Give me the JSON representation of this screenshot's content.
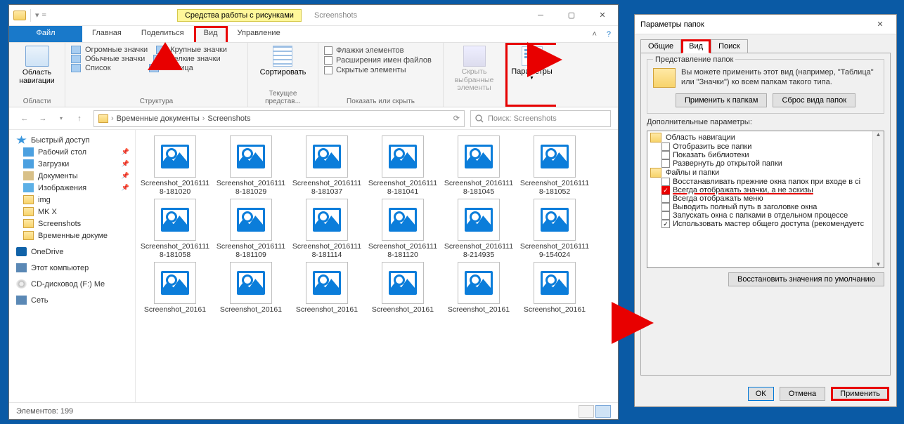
{
  "explorer": {
    "context_tab": "Средства работы с рисунками",
    "title": "Screenshots",
    "tabs": {
      "file": "Файл",
      "home": "Главная",
      "share": "Поделиться",
      "view": "Вид",
      "manage": "Управление"
    },
    "ribbon": {
      "nav_pane": "Область навигации",
      "g_panes": "Области",
      "layout": {
        "huge": "Огромные значки",
        "large": "Крупные значки",
        "normal": "Обычные значки",
        "small": "Мелкие значки",
        "list": "Список",
        "table": "Таблица"
      },
      "g_layout": "Структура",
      "sort": "Сортировать",
      "g_view": "Текущее представ...",
      "show": {
        "chk": "Флажки элементов",
        "ext": "Расширения имен файлов",
        "hidden": "Скрытые элементы"
      },
      "g_show": "Показать или скрыть",
      "hide": "Скрыть выбранные элементы",
      "params": "Параметры"
    },
    "breadcrumb": [
      "Временные документы",
      "Screenshots"
    ],
    "search_ph": "Поиск: Screenshots",
    "sidebar": {
      "quick": "Быстрый доступ",
      "desktop": "Рабочий стол",
      "downloads": "Загрузки",
      "documents": "Документы",
      "pictures": "Изображения",
      "img": "img",
      "mkx": "MK X",
      "screenshots": "Screenshots",
      "temp": "Временные докуме",
      "onedrive": "OneDrive",
      "thispc": "Этот компьютер",
      "cd": "CD-дисковод (F:) Me",
      "network": "Сеть"
    },
    "files": [
      "Screenshot_20161118-181020",
      "Screenshot_20161118-181029",
      "Screenshot_20161118-181037",
      "Screenshot_20161118-181041",
      "Screenshot_20161118-181045",
      "Screenshot_20161118-181052",
      "Screenshot_20161118-181058",
      "Screenshot_20161118-181109",
      "Screenshot_20161118-181114",
      "Screenshot_20161118-181120",
      "Screenshot_20161118-214935",
      "Screenshot_20161119-154024",
      "Screenshot_20161",
      "Screenshot_20161",
      "Screenshot_20161",
      "Screenshot_20161",
      "Screenshot_20161",
      "Screenshot_20161"
    ],
    "status": "Элементов: 199"
  },
  "dialog": {
    "title": "Параметры папок",
    "tabs": {
      "general": "Общие",
      "view": "Вид",
      "search": "Поиск"
    },
    "group1": {
      "title": "Представление папок",
      "text": "Вы можете применить этот вид (например, \"Таблица\" или \"Значки\") ко всем папкам такого типа.",
      "apply": "Применить к папкам",
      "reset": "Сброс вида папок"
    },
    "adv": "Дополнительные параметры:",
    "tree": {
      "nav": "Область навигации",
      "nav1": "Отобразить все папки",
      "nav2": "Показать библиотеки",
      "nav3": "Развернуть до открытой папки",
      "ff": "Файлы и папки",
      "ff1": "Восстанавливать прежние окна папок при входе в сі",
      "ff2": "Всегда отображать значки, а не эскизы",
      "ff3": "Всегда отображать меню",
      "ff4": "Выводить полный путь в заголовке окна",
      "ff5": "Запускать окна с папками в отдельном процессе",
      "ff6": "Использовать мастер общего доступа (рекомендуетс"
    },
    "restore": "Восстановить значения по умолчанию",
    "ok": "ОК",
    "cancel": "Отмена",
    "apply": "Применить"
  }
}
